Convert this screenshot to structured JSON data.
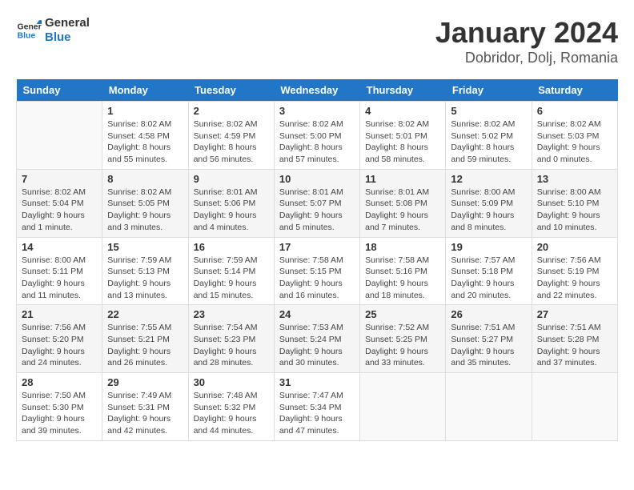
{
  "logo": {
    "line1": "General",
    "line2": "Blue"
  },
  "title": "January 2024",
  "subtitle": "Dobridor, Dolj, Romania",
  "weekdays": [
    "Sunday",
    "Monday",
    "Tuesday",
    "Wednesday",
    "Thursday",
    "Friday",
    "Saturday"
  ],
  "weeks": [
    [
      {
        "day": "",
        "sunrise": "",
        "sunset": "",
        "daylight": ""
      },
      {
        "day": "1",
        "sunrise": "Sunrise: 8:02 AM",
        "sunset": "Sunset: 4:58 PM",
        "daylight": "Daylight: 8 hours and 55 minutes."
      },
      {
        "day": "2",
        "sunrise": "Sunrise: 8:02 AM",
        "sunset": "Sunset: 4:59 PM",
        "daylight": "Daylight: 8 hours and 56 minutes."
      },
      {
        "day": "3",
        "sunrise": "Sunrise: 8:02 AM",
        "sunset": "Sunset: 5:00 PM",
        "daylight": "Daylight: 8 hours and 57 minutes."
      },
      {
        "day": "4",
        "sunrise": "Sunrise: 8:02 AM",
        "sunset": "Sunset: 5:01 PM",
        "daylight": "Daylight: 8 hours and 58 minutes."
      },
      {
        "day": "5",
        "sunrise": "Sunrise: 8:02 AM",
        "sunset": "Sunset: 5:02 PM",
        "daylight": "Daylight: 8 hours and 59 minutes."
      },
      {
        "day": "6",
        "sunrise": "Sunrise: 8:02 AM",
        "sunset": "Sunset: 5:03 PM",
        "daylight": "Daylight: 9 hours and 0 minutes."
      }
    ],
    [
      {
        "day": "7",
        "sunrise": "Sunrise: 8:02 AM",
        "sunset": "Sunset: 5:04 PM",
        "daylight": "Daylight: 9 hours and 1 minute."
      },
      {
        "day": "8",
        "sunrise": "Sunrise: 8:02 AM",
        "sunset": "Sunset: 5:05 PM",
        "daylight": "Daylight: 9 hours and 3 minutes."
      },
      {
        "day": "9",
        "sunrise": "Sunrise: 8:01 AM",
        "sunset": "Sunset: 5:06 PM",
        "daylight": "Daylight: 9 hours and 4 minutes."
      },
      {
        "day": "10",
        "sunrise": "Sunrise: 8:01 AM",
        "sunset": "Sunset: 5:07 PM",
        "daylight": "Daylight: 9 hours and 5 minutes."
      },
      {
        "day": "11",
        "sunrise": "Sunrise: 8:01 AM",
        "sunset": "Sunset: 5:08 PM",
        "daylight": "Daylight: 9 hours and 7 minutes."
      },
      {
        "day": "12",
        "sunrise": "Sunrise: 8:00 AM",
        "sunset": "Sunset: 5:09 PM",
        "daylight": "Daylight: 9 hours and 8 minutes."
      },
      {
        "day": "13",
        "sunrise": "Sunrise: 8:00 AM",
        "sunset": "Sunset: 5:10 PM",
        "daylight": "Daylight: 9 hours and 10 minutes."
      }
    ],
    [
      {
        "day": "14",
        "sunrise": "Sunrise: 8:00 AM",
        "sunset": "Sunset: 5:11 PM",
        "daylight": "Daylight: 9 hours and 11 minutes."
      },
      {
        "day": "15",
        "sunrise": "Sunrise: 7:59 AM",
        "sunset": "Sunset: 5:13 PM",
        "daylight": "Daylight: 9 hours and 13 minutes."
      },
      {
        "day": "16",
        "sunrise": "Sunrise: 7:59 AM",
        "sunset": "Sunset: 5:14 PM",
        "daylight": "Daylight: 9 hours and 15 minutes."
      },
      {
        "day": "17",
        "sunrise": "Sunrise: 7:58 AM",
        "sunset": "Sunset: 5:15 PM",
        "daylight": "Daylight: 9 hours and 16 minutes."
      },
      {
        "day": "18",
        "sunrise": "Sunrise: 7:58 AM",
        "sunset": "Sunset: 5:16 PM",
        "daylight": "Daylight: 9 hours and 18 minutes."
      },
      {
        "day": "19",
        "sunrise": "Sunrise: 7:57 AM",
        "sunset": "Sunset: 5:18 PM",
        "daylight": "Daylight: 9 hours and 20 minutes."
      },
      {
        "day": "20",
        "sunrise": "Sunrise: 7:56 AM",
        "sunset": "Sunset: 5:19 PM",
        "daylight": "Daylight: 9 hours and 22 minutes."
      }
    ],
    [
      {
        "day": "21",
        "sunrise": "Sunrise: 7:56 AM",
        "sunset": "Sunset: 5:20 PM",
        "daylight": "Daylight: 9 hours and 24 minutes."
      },
      {
        "day": "22",
        "sunrise": "Sunrise: 7:55 AM",
        "sunset": "Sunset: 5:21 PM",
        "daylight": "Daylight: 9 hours and 26 minutes."
      },
      {
        "day": "23",
        "sunrise": "Sunrise: 7:54 AM",
        "sunset": "Sunset: 5:23 PM",
        "daylight": "Daylight: 9 hours and 28 minutes."
      },
      {
        "day": "24",
        "sunrise": "Sunrise: 7:53 AM",
        "sunset": "Sunset: 5:24 PM",
        "daylight": "Daylight: 9 hours and 30 minutes."
      },
      {
        "day": "25",
        "sunrise": "Sunrise: 7:52 AM",
        "sunset": "Sunset: 5:25 PM",
        "daylight": "Daylight: 9 hours and 33 minutes."
      },
      {
        "day": "26",
        "sunrise": "Sunrise: 7:51 AM",
        "sunset": "Sunset: 5:27 PM",
        "daylight": "Daylight: 9 hours and 35 minutes."
      },
      {
        "day": "27",
        "sunrise": "Sunrise: 7:51 AM",
        "sunset": "Sunset: 5:28 PM",
        "daylight": "Daylight: 9 hours and 37 minutes."
      }
    ],
    [
      {
        "day": "28",
        "sunrise": "Sunrise: 7:50 AM",
        "sunset": "Sunset: 5:30 PM",
        "daylight": "Daylight: 9 hours and 39 minutes."
      },
      {
        "day": "29",
        "sunrise": "Sunrise: 7:49 AM",
        "sunset": "Sunset: 5:31 PM",
        "daylight": "Daylight: 9 hours and 42 minutes."
      },
      {
        "day": "30",
        "sunrise": "Sunrise: 7:48 AM",
        "sunset": "Sunset: 5:32 PM",
        "daylight": "Daylight: 9 hours and 44 minutes."
      },
      {
        "day": "31",
        "sunrise": "Sunrise: 7:47 AM",
        "sunset": "Sunset: 5:34 PM",
        "daylight": "Daylight: 9 hours and 47 minutes."
      },
      {
        "day": "",
        "sunrise": "",
        "sunset": "",
        "daylight": ""
      },
      {
        "day": "",
        "sunrise": "",
        "sunset": "",
        "daylight": ""
      },
      {
        "day": "",
        "sunrise": "",
        "sunset": "",
        "daylight": ""
      }
    ]
  ]
}
